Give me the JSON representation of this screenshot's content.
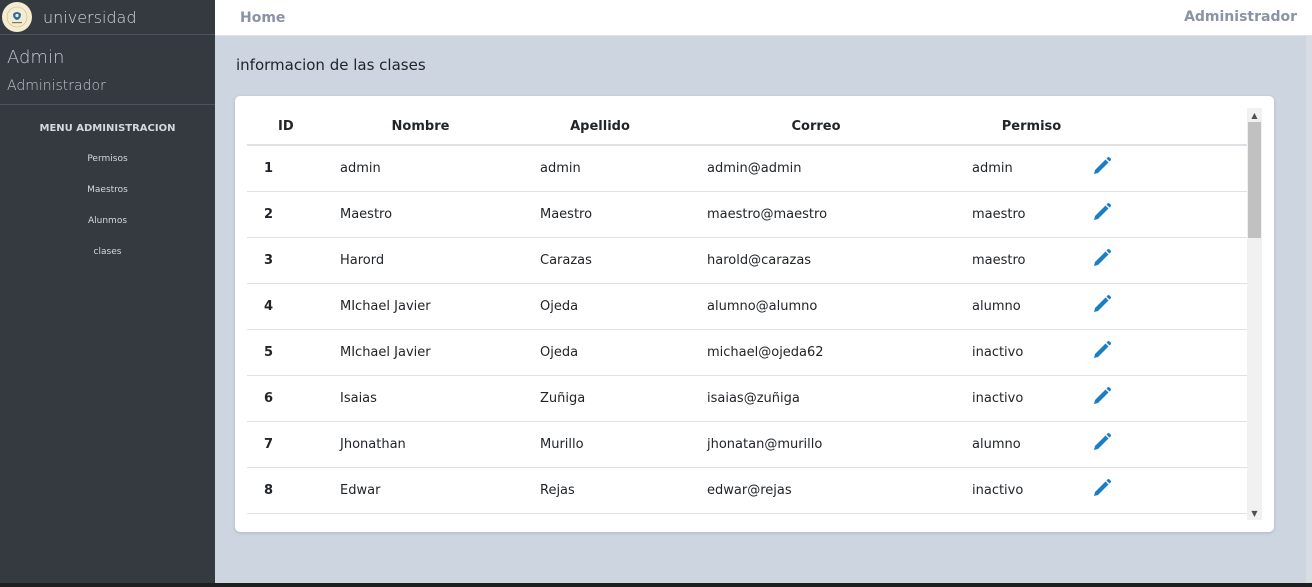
{
  "brand": {
    "name": "universidad",
    "logo_icon": "university-seal-icon"
  },
  "user": {
    "name": "Admin",
    "role": "Administrador"
  },
  "menu": {
    "header": "MENU ADMINISTRACION",
    "items": [
      {
        "label": "Permisos"
      },
      {
        "label": "Maestros"
      },
      {
        "label": "Alunmos"
      },
      {
        "label": "clases"
      }
    ]
  },
  "topbar": {
    "home": "Home",
    "user": "Administrador"
  },
  "page": {
    "title": "informacion de las clases"
  },
  "table": {
    "headers": [
      "ID",
      "Nombre",
      "Apellido",
      "Correo",
      "Permiso"
    ],
    "rows": [
      {
        "id": "1",
        "nombre": "admin",
        "apellido": "admin",
        "correo": "admin@admin",
        "permiso": "admin"
      },
      {
        "id": "2",
        "nombre": "Maestro",
        "apellido": "Maestro",
        "correo": "maestro@maestro",
        "permiso": "maestro"
      },
      {
        "id": "3",
        "nombre": "Harord",
        "apellido": "Carazas",
        "correo": "harold@carazas",
        "permiso": "maestro"
      },
      {
        "id": "4",
        "nombre": "MIchael Javier",
        "apellido": "Ojeda",
        "correo": "alumno@alumno",
        "permiso": "alumno"
      },
      {
        "id": "5",
        "nombre": "MIchael Javier",
        "apellido": "Ojeda",
        "correo": "michael@ojeda62",
        "permiso": "inactivo"
      },
      {
        "id": "6",
        "nombre": "Isaias",
        "apellido": "Zuñiga",
        "correo": "isaias@zuñiga",
        "permiso": "inactivo"
      },
      {
        "id": "7",
        "nombre": "Jhonathan",
        "apellido": "Murillo",
        "correo": "jhonatan@murillo",
        "permiso": "alumno"
      },
      {
        "id": "8",
        "nombre": "Edwar",
        "apellido": "Rejas",
        "correo": "edwar@rejas",
        "permiso": "inactivo"
      }
    ],
    "edit_icon": "pencil-icon"
  },
  "colors": {
    "sidebar": "#343a40",
    "background": "#ccd5e0",
    "edit_icon": "#1a7fc1"
  }
}
